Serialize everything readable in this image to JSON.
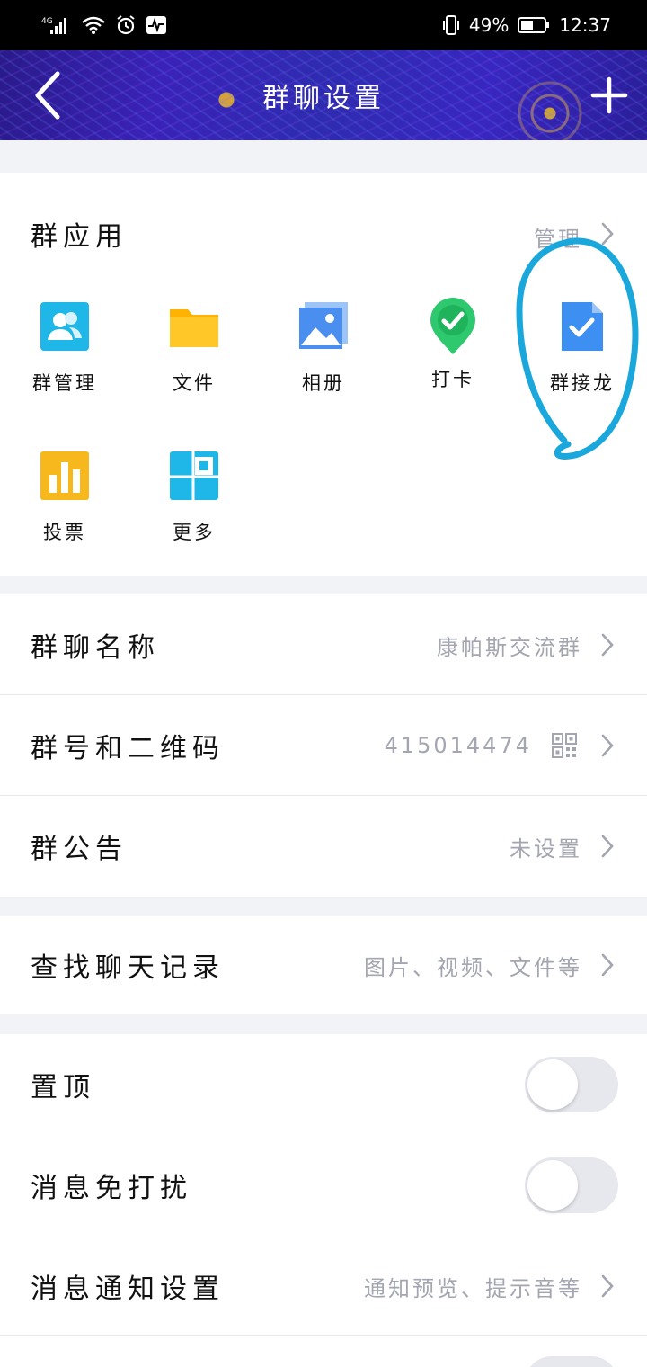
{
  "status_bar": {
    "network": "4G",
    "battery": "49%",
    "time": "12:37"
  },
  "header": {
    "title": "群聊设置"
  },
  "group_apps": {
    "title": "群应用",
    "manage_label": "管理",
    "apps": [
      {
        "label": "群管理",
        "icon": "group-manage-icon",
        "color": "#1fb6e8"
      },
      {
        "label": "文件",
        "icon": "folder-icon",
        "color": "#ffc21a"
      },
      {
        "label": "相册",
        "icon": "photo-album-icon",
        "color": "#4a8ef0"
      },
      {
        "label": "打卡",
        "icon": "check-in-icon",
        "color": "#2ec86e"
      },
      {
        "label": "群接龙",
        "icon": "group-relay-icon",
        "color": "#3d8ff2"
      },
      {
        "label": "投票",
        "icon": "vote-icon",
        "color": "#f6b81c"
      },
      {
        "label": "更多",
        "icon": "more-apps-icon",
        "color": "#1fb6e8"
      }
    ]
  },
  "info_rows": [
    {
      "label": "群聊名称",
      "value": "康帕斯交流群"
    },
    {
      "label": "群号和二维码",
      "value": "415014474"
    },
    {
      "label": "群公告",
      "value": "未设置"
    }
  ],
  "search_row": {
    "label": "查找聊天记录",
    "value": "图片、视频、文件等"
  },
  "settings_rows": [
    {
      "label": "置顶",
      "toggle": false
    },
    {
      "label": "消息免打扰",
      "toggle": false
    },
    {
      "label": "消息通知设置",
      "value": "通知预览、提示音等"
    }
  ],
  "colors": {
    "annotation": "#1aa7dc",
    "secondary_text": "#a3a6b0",
    "toggle_off": "#e6e8ee"
  }
}
